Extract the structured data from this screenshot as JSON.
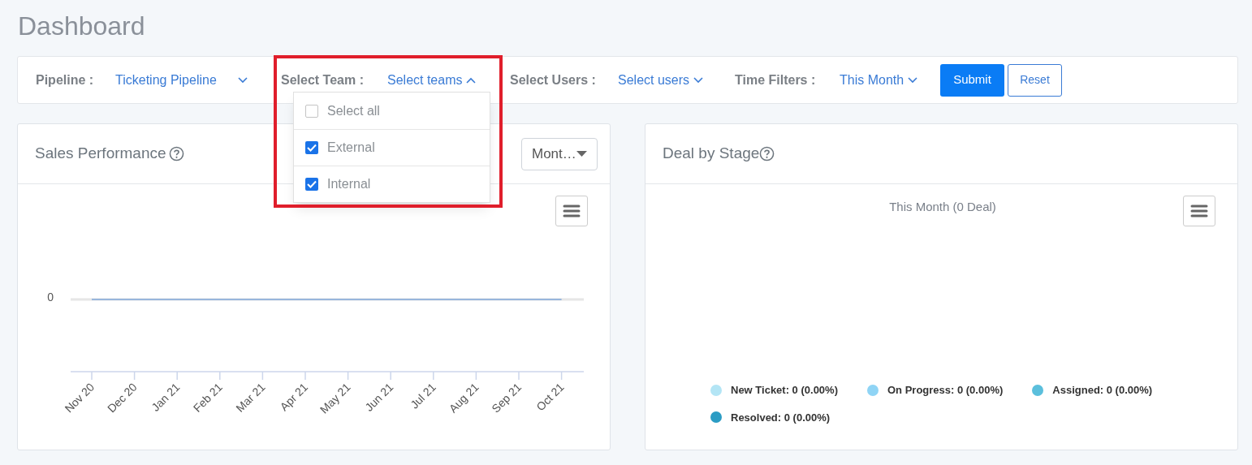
{
  "page_title": "Dashboard",
  "filters": [
    {
      "label": "Pipeline :",
      "value": "Ticketing Pipeline",
      "expanded": false
    },
    {
      "label": "Select Team :",
      "value": "Select teams",
      "expanded": true
    },
    {
      "label": "Select Users :",
      "value": "Select users",
      "expanded": false
    },
    {
      "label": "Time Filters :",
      "value": "This Month",
      "expanded": false
    }
  ],
  "buttons": [
    {
      "label": "Submit",
      "kind": "primary"
    },
    {
      "label": "Reset",
      "kind": "outline"
    }
  ],
  "team_dropdown": {
    "options": [
      {
        "label": "Select all",
        "checked": false
      },
      {
        "label": "External",
        "checked": true
      },
      {
        "label": "Internal",
        "checked": true
      }
    ]
  },
  "sales_performance": {
    "title": "Sales Performance",
    "period_select": "Mont…",
    "y_tick_labels": [
      "0"
    ],
    "x_axis_labels": [
      "Nov 20",
      "Dec 20",
      "Jan 21",
      "Feb 21",
      "Mar 21",
      "Apr 21",
      "May 21",
      "Jun 21",
      "Jul 21",
      "Aug 21",
      "Sep 21",
      "Oct 21"
    ]
  },
  "deal_by_stage": {
    "title": "Deal by Stage",
    "subtitle": "This Month (0 Deal)",
    "legend": [
      {
        "label": "New Ticket: 0 (0.00%)",
        "color": "#b3e5f5"
      },
      {
        "label": "On Progress: 0 (0.00%)",
        "color": "#8fd4f5"
      },
      {
        "label": "Assigned: 0 (0.00%)",
        "color": "#5bbfdc"
      },
      {
        "label": "Resolved: 0 (0.00%)",
        "color": "#2b9cc4"
      }
    ]
  }
}
